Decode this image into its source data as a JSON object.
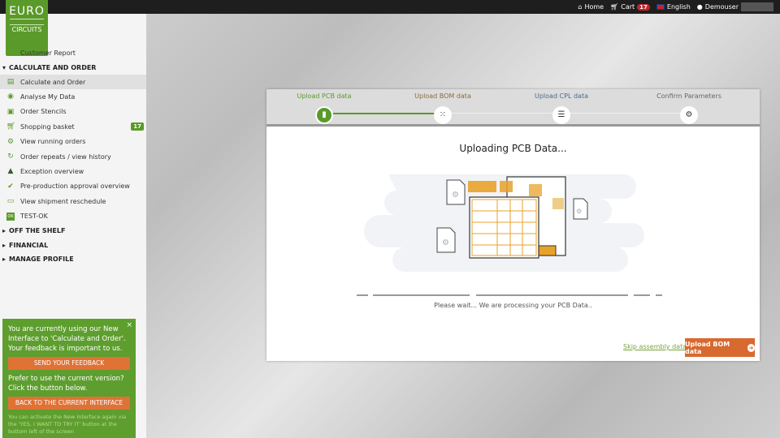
{
  "topbar": {
    "home": "Home",
    "cart": "Cart",
    "cart_count": "17",
    "language": "English",
    "user": "Demouser"
  },
  "logo": {
    "line1": "EURO",
    "line2": "CIRCUITS"
  },
  "sidebar": {
    "customer_report": "Customer Report",
    "sections": [
      "CALCULATE AND ORDER",
      "OFF THE SHELF",
      "FINANCIAL",
      "MANAGE PROFILE"
    ],
    "items": [
      {
        "label": "Calculate and Order",
        "icon": "calculator-icon"
      },
      {
        "label": "Analyse My Data",
        "icon": "eye-icon"
      },
      {
        "label": "Order Stencils",
        "icon": "stencil-icon"
      },
      {
        "label": "Shopping basket",
        "icon": "cart-icon",
        "badge": "17"
      },
      {
        "label": "View running orders",
        "icon": "gears-icon"
      },
      {
        "label": "Order repeats / view history",
        "icon": "refresh-icon"
      },
      {
        "label": "Exception overview",
        "icon": "warning-icon"
      },
      {
        "label": "Pre-production approval overview",
        "icon": "shield-check-icon"
      },
      {
        "label": "View shipment reschedule",
        "icon": "calendar-icon"
      },
      {
        "label": "TEST-OK",
        "icon": "ok-icon"
      }
    ]
  },
  "feedback": {
    "text1": "You are currently using our New Interface to 'Calculate and Order'. Your feedback is important to us.",
    "btn1": "SEND YOUR FEEDBACK",
    "text2": "Prefer to use the current version? Click the button below.",
    "btn2": "BACK TO THE CURRENT INTERFACE",
    "note": "You can activate the New Interface again via the 'YES, I WANT TO TRY IT' button at the bottom left of the screen",
    "close": "×"
  },
  "wizard": {
    "steps": [
      "Upload PCB data",
      "Upload BOM data",
      "Upload CPL data",
      "Confirm Parameters"
    ],
    "active_step": 0,
    "title": "Uploading PCB Data...",
    "wait": "Please wait... We are processing your PCB Data..",
    "skip": "Skip assembly data",
    "next": "Upload BOM data"
  },
  "colors": {
    "green": "#5a9a2a",
    "orange": "#d8692f",
    "accent": "#e8a22a"
  }
}
